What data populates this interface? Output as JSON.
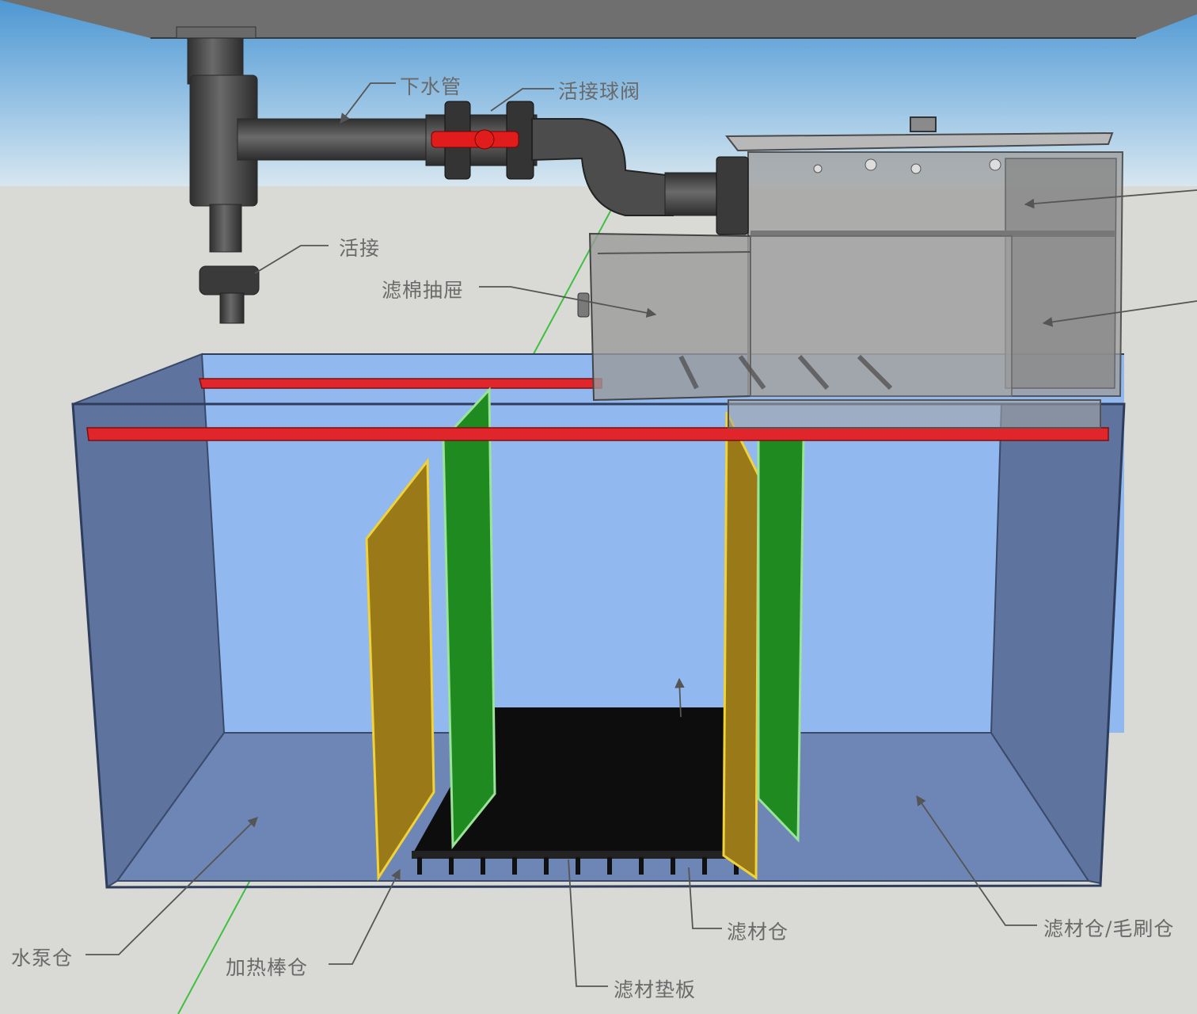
{
  "labels": {
    "drain_pipe": "下水管",
    "union_ball_valve": "活接球阀",
    "union": "活接",
    "sponge_drawer": "滤棉抽屉",
    "pump_chamber": "水泵仓",
    "heater_chamber": "加热棒仓",
    "media_chamber": "滤材仓",
    "media_plate": "滤材垫板",
    "media_brush_chamber": "滤材仓/毛刷仓"
  },
  "colors": {
    "ceiling": "#6f6f6f",
    "sky_top": "#5aa0d6",
    "floor": "#d9d9d6",
    "water": "#8fb6ee",
    "tank_wall": "#6c84b4",
    "red_bar": "#e0262a",
    "green_baffle": "#1f8a1f",
    "brown_baffle": "#9a7a18",
    "media_plate": "#0d0d0d",
    "pipe": "#4a4a4a",
    "valve_handle": "#e01c1c",
    "label_text": "#6a6a6a"
  }
}
